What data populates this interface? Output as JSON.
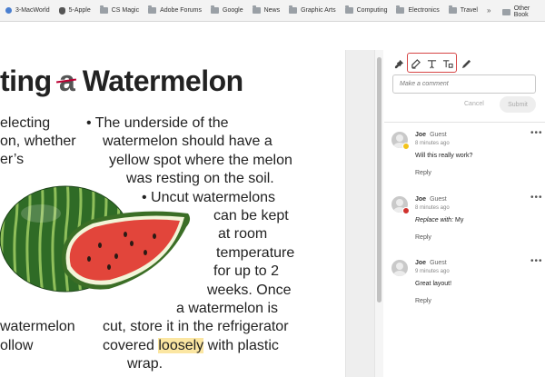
{
  "bookmarks": {
    "items": [
      {
        "label": "3-MacWorld",
        "icon": "globe-icon"
      },
      {
        "label": "5-Apple",
        "icon": "apple-icon"
      },
      {
        "label": "CS Magic",
        "icon": "folder-icon"
      },
      {
        "label": "Adobe Forums",
        "icon": "folder-icon"
      },
      {
        "label": "Google",
        "icon": "folder-icon"
      },
      {
        "label": "News",
        "icon": "folder-icon"
      },
      {
        "label": "Graphic Arts",
        "icon": "folder-icon"
      },
      {
        "label": "Computing",
        "icon": "folder-icon"
      },
      {
        "label": "Electronics",
        "icon": "folder-icon"
      },
      {
        "label": "Travel",
        "icon": "folder-icon"
      }
    ],
    "more": "»",
    "other": "Other Book"
  },
  "document": {
    "title_pre": "ting ",
    "title_struck": "a",
    "title_post": " Watermelon",
    "left_lines": [
      "electing",
      "on, whether",
      "er’s",
      "watermelon",
      "ollow"
    ],
    "right_lines": [
      "•  The underside of the",
      "watermelon should have a",
      "yellow spot where the melon",
      "was resting on the soil.",
      "•  Uncut watermelons",
      "can be kept",
      "at room",
      "temperature",
      "for up to 2",
      "weeks. Once",
      "a watermelon is",
      "cut, store it in the refrigerator",
      "covered",
      "loosely",
      " with plastic",
      "wrap."
    ],
    "highlight_color": "#fbe6a2",
    "strike_color": "#b00033"
  },
  "panel": {
    "tools": [
      "pin-icon",
      "highlight-icon",
      "insert-text-icon",
      "replace-text-icon",
      "draw-icon"
    ],
    "placeholder": "Make a comment",
    "cancel": "Cancel",
    "submit": "Submit",
    "comments": [
      {
        "name": "Joe",
        "role": "Guest",
        "time": "8 minutes ago",
        "text": "Will this really work?",
        "text_prefix": "",
        "reply": "Reply",
        "more": "•••",
        "badge_color": "#f2c31b"
      },
      {
        "name": "Joe",
        "role": "Guest",
        "time": "8 minutes ago",
        "text": "My",
        "text_prefix": "Replace with:",
        "reply": "Reply",
        "more": "•••",
        "badge_color": "#d0312d"
      },
      {
        "name": "Joe",
        "role": "Guest",
        "time": "9 minutes ago",
        "text": "Great layout!",
        "text_prefix": "",
        "reply": "Reply",
        "more": "•••",
        "badge_color": ""
      }
    ]
  }
}
